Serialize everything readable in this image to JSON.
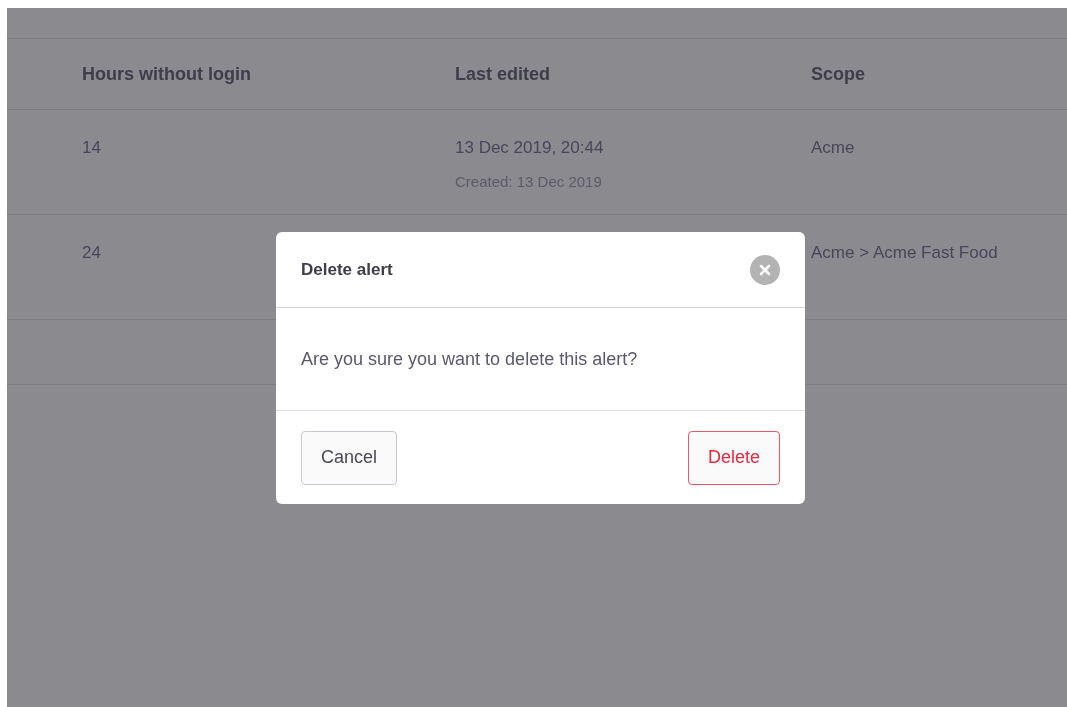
{
  "table": {
    "columns": [
      "Hours without login",
      "Last edited",
      "Scope"
    ],
    "rows": [
      {
        "hours": "14",
        "last_edited": "13 Dec 2019, 20:44",
        "created": "Created: 13 Dec 2019",
        "scope": "Acme"
      },
      {
        "hours": "24",
        "scope": "Acme > Acme Fast Food"
      }
    ]
  },
  "dialog": {
    "title": "Delete alert",
    "message": "Are you sure you want to delete this alert?",
    "buttons": [
      {
        "label": "Cancel",
        "kind": "secondary"
      },
      {
        "label": "Delete",
        "kind": "danger"
      }
    ]
  }
}
